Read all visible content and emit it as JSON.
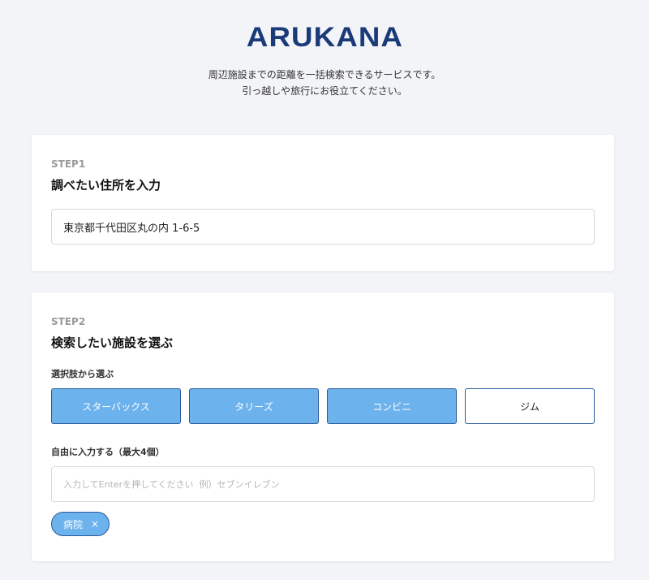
{
  "header": {
    "logo": "ARUKANA",
    "tagline_line1": "周辺施設までの距離を一括検索できるサービスです。",
    "tagline_line2": "引っ越しや旅行にお役立てください。"
  },
  "step1": {
    "label": "STEP1",
    "title": "調べたい住所を入力",
    "address_value": "東京都千代田区丸の内 1-6-5"
  },
  "step2": {
    "label": "STEP2",
    "title": "検索したい施設を選ぶ",
    "choice_label": "選択肢から選ぶ",
    "options": [
      {
        "label": "スターバックス",
        "selected": true
      },
      {
        "label": "タリーズ",
        "selected": true
      },
      {
        "label": "コンビニ",
        "selected": true
      },
      {
        "label": "ジム",
        "selected": false
      }
    ],
    "free_label": "自由に入力する（最大4個）",
    "free_placeholder": "入力してEnterを押してください  例）セブンイレブン",
    "tags": [
      {
        "label": "病院",
        "remove": "×"
      }
    ]
  },
  "colors": {
    "brand": "#1b3a78",
    "accent": "#6cb2ec",
    "border_dark": "#2a5a9a",
    "background": "#f3f4f8"
  }
}
